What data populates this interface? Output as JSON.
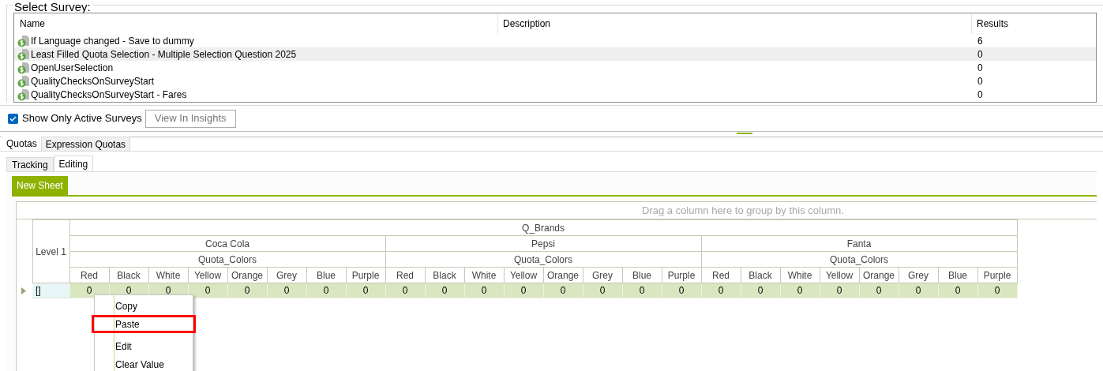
{
  "survey_group": {
    "title": "Select Survey:"
  },
  "survey_list": {
    "columns": [
      "Name",
      "Description",
      "Results"
    ],
    "rows": [
      {
        "name": "If Language changed - Save to dummy",
        "results": "6",
        "selected": false
      },
      {
        "name": "Least Filled Quota Selection - Multiple Selection Question 2025",
        "results": "0",
        "selected": true
      },
      {
        "name": "OpenUserSelection",
        "results": "0",
        "selected": false
      },
      {
        "name": "QualityChecksOnSurveyStart",
        "results": "0",
        "selected": false
      },
      {
        "name": "QualityChecksOnSurveyStart - Fares",
        "results": "0",
        "selected": false
      }
    ]
  },
  "show_active": {
    "label": "Show Only Active Surveys",
    "checked": true
  },
  "insights_button": "View In Insights",
  "tabs": [
    {
      "label": "Quotas",
      "selected": true
    },
    {
      "label": "Expression Quotas",
      "selected": false
    }
  ],
  "subtabs": [
    {
      "label": "Tracking",
      "selected": false
    },
    {
      "label": "Editing",
      "selected": true
    }
  ],
  "sheet_tabs": [
    {
      "label": "New Sheet",
      "selected": true
    }
  ],
  "grid": {
    "group_hint": "Drag a column here to group by this column.",
    "top_header": "Q_Brands",
    "row_header": "Level 1",
    "brands": [
      {
        "name": "Coca Cola",
        "subheader": "Quota_Colors",
        "colors": [
          "Red",
          "Black",
          "White",
          "Yellow",
          "Orange",
          "Grey",
          "Blue",
          "Purple"
        ]
      },
      {
        "name": "Pepsi",
        "subheader": "Quota_Colors",
        "colors": [
          "Red",
          "Black",
          "White",
          "Yellow",
          "Orange",
          "Grey",
          "Blue",
          "Purple"
        ]
      },
      {
        "name": "Fanta",
        "subheader": "Quota_Colors",
        "colors": [
          "Red",
          "Black",
          "White",
          "Yellow",
          "Orange",
          "Grey",
          "Blue",
          "Purple"
        ]
      }
    ],
    "rows": [
      {
        "label": "[]",
        "values": [
          "0",
          "0",
          "0",
          "0",
          "0",
          "0",
          "0",
          "0",
          "0",
          "0",
          "0",
          "0",
          "0",
          "0",
          "0",
          "0",
          "0",
          "0",
          "0",
          "0",
          "0",
          "0",
          "0",
          "0"
        ]
      }
    ]
  },
  "context_menu": {
    "items": [
      {
        "label": "Copy",
        "highlighted": false
      },
      {
        "label": "Paste",
        "highlighted": true
      },
      {
        "label": "Edit",
        "highlighted": false
      },
      {
        "label": "Clear Value",
        "highlighted": false
      }
    ]
  }
}
